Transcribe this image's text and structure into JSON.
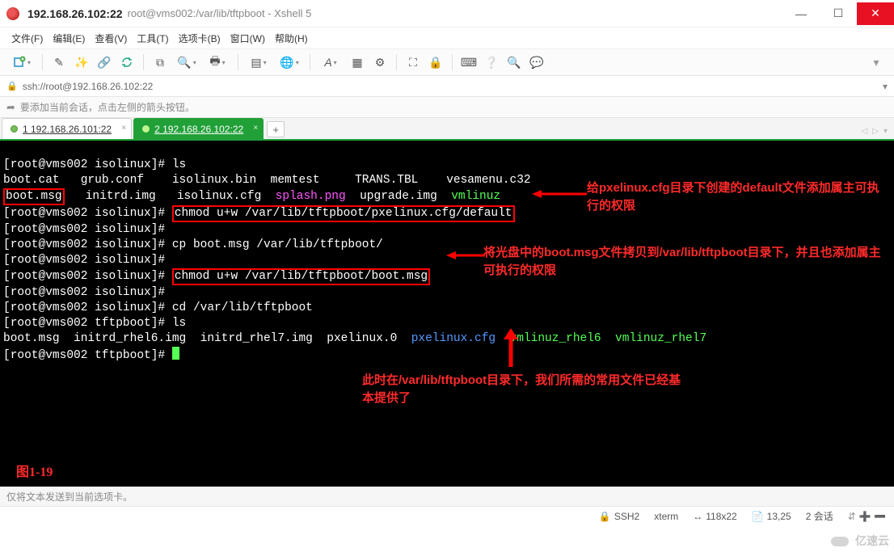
{
  "window": {
    "ip": "192.168.26.102:22",
    "rest": "root@vms002:/var/lib/tftpboot - Xshell 5"
  },
  "menu": {
    "file": "文件(F)",
    "edit": "编辑(E)",
    "view": "查看(V)",
    "tools": "工具(T)",
    "tabs": "选项卡(B)",
    "window": "窗口(W)",
    "help": "帮助(H)"
  },
  "address": {
    "url": "ssh://root@192.168.26.102:22"
  },
  "hint": {
    "text": "要添加当前会话，点击左侧的箭头按钮。"
  },
  "tabs": {
    "t1": "1 192.168.26.101:22",
    "t2": "2 192.168.26.102:22",
    "add": "+"
  },
  "term": {
    "l1a": "[root@vms002 isolinux]# ",
    "l1b": "ls",
    "l2": "boot.cat   grub.conf    isolinux.bin  memtest     TRANS.TBL    vesamenu.c32",
    "l3a": "boot.msg",
    "l3b": "   initrd.img   isolinux.cfg  ",
    "l3c": "splash.png",
    "l3d": "  upgrade.img  ",
    "l3e": "vmlinuz",
    "l4a": "[root@vms002 isolinux]# ",
    "l4b": "chmod u+w /var/lib/tftpboot/pxelinux.cfg/default",
    "l5": "[root@vms002 isolinux]# ",
    "l6a": "[root@vms002 isolinux]# ",
    "l6b": "cp boot.msg /var/lib/tftpboot/",
    "l7": "[root@vms002 isolinux]# ",
    "l8a": "[root@vms002 isolinux]# ",
    "l8b": "chmod u+w /var/lib/tftpboot/boot.msg",
    "l9": "[root@vms002 isolinux]# ",
    "l10a": "[root@vms002 isolinux]# ",
    "l10b": "cd /var/lib/tftpboot",
    "l11a": "[root@vms002 tftpboot]# ",
    "l11b": "ls",
    "l12a": "boot.msg  initrd_rhel6.img  initrd_rhel7.img  pxelinux.0  ",
    "l12b": "pxelinux.cfg",
    "l12c": "  ",
    "l12d": "vmlinuz_rhel6",
    "l12e": "  ",
    "l12f": "vmlinuz_rhel7",
    "l13": "[root@vms002 tftpboot]# "
  },
  "annot": {
    "a1": "给pxelinux.cfg目录下创建的default文件添加属主可执行的权限",
    "a2": "将光盘中的boot.msg文件拷贝到/var/lib/tftpboot目录下，并且也添加属主可执行的权限",
    "a3": "此时在/var/lib/tftpboot目录下，我们所需的常用文件已经基本提供了",
    "fig": "图1-19"
  },
  "status": {
    "hint": "仅将文本发送到当前选项卡。",
    "proto": "SSH2",
    "term": "xterm",
    "size": "118x22",
    "pos": "13,25",
    "sess": "2 会话"
  },
  "watermark": "亿速云",
  "icons": {
    "lock": "🔒",
    "arrow_add": "➦",
    "min": "—",
    "max": "☐",
    "close": "✕",
    "left": "◁",
    "right": "▷",
    "down": "▾",
    "resize": "↔",
    "pin": "⇵"
  }
}
